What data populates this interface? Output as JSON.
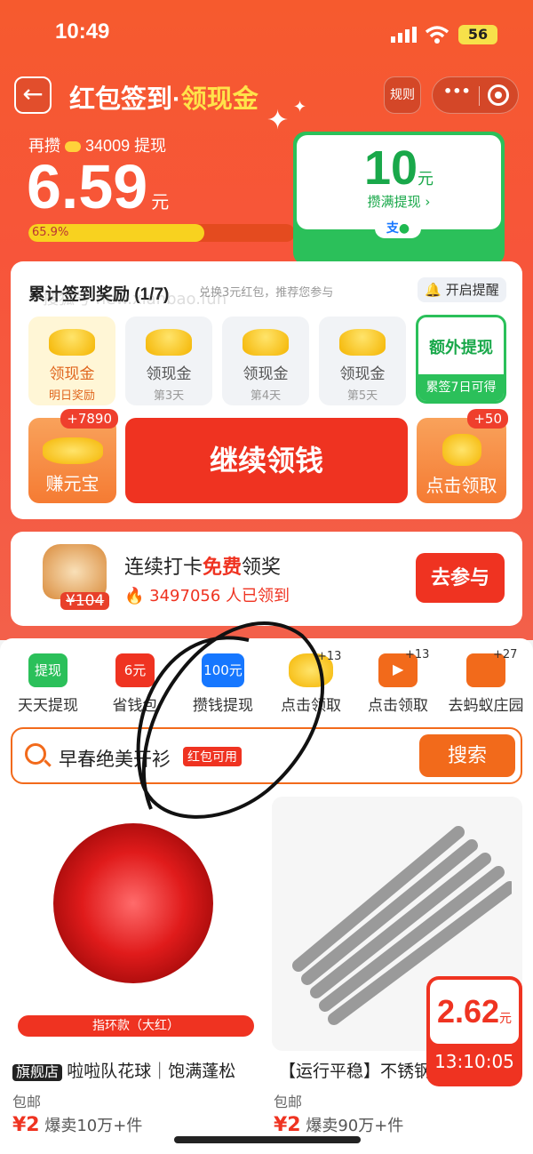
{
  "status": {
    "time": "10:49",
    "battery": "56"
  },
  "header": {
    "title": "红包签到",
    "dot": "·",
    "title_accent": "领现金",
    "rules": "规则",
    "more": "•••"
  },
  "balance": {
    "prefix": "再攒",
    "coins": "34009",
    "suffix": "提现",
    "amount": "6.59",
    "unit": "元",
    "progress_label": "65.9%",
    "progress": 0.659
  },
  "withdraw": {
    "amount": "10",
    "unit": "元",
    "label": "攒满提现 ›"
  },
  "signin": {
    "title": "累计签到奖励 (1/7)",
    "subtitle": "兑换3元红包，推荐您参与",
    "reminder": "开启提醒",
    "days": [
      {
        "label": "领现金",
        "sub": "明日奖励"
      },
      {
        "label": "领现金",
        "sub": "第3天"
      },
      {
        "label": "领现金",
        "sub": "第4天"
      },
      {
        "label": "领现金",
        "sub": "第5天"
      }
    ],
    "extra": {
      "label": "额外提现",
      "sub": "累签7日可得"
    },
    "earn": {
      "badge": "+7890",
      "label": "赚元宝"
    },
    "continue": "继续领钱",
    "claim": {
      "badge": "+50",
      "label": "点击领取"
    }
  },
  "promo": {
    "price": "¥104",
    "title_a": "连续打卡",
    "title_b": "免费",
    "title_c": "领奖",
    "count": "3497056 人已领到",
    "button": "去参与"
  },
  "shortcuts": [
    {
      "icon": "提现",
      "label": "天天提现"
    },
    {
      "icon": "6元",
      "label": "省钱包"
    },
    {
      "icon": "100元",
      "label": "攒钱提现"
    },
    {
      "icon": "+13",
      "label": "点击领取"
    },
    {
      "icon": "+13",
      "label": "点击领取"
    },
    {
      "icon": "+27",
      "label": "去蚂蚁庄园"
    }
  ],
  "search": {
    "text": "早春绝美开衫",
    "tag": "红包可用",
    "button": "搜索"
  },
  "products": [
    {
      "ribbon": "指环款（大红）",
      "shop": "旗舰店",
      "title": "啦啦队花球｜饱满蓬松",
      "shipping": "包邮",
      "price": "¥2",
      "sold": "爆卖10万+件"
    },
    {
      "title": "【运行平稳】不锈钢",
      "shipping": "包邮",
      "price": "¥2",
      "sold": "爆卖90万+件"
    }
  ],
  "float_reward": {
    "amount": "2.62",
    "unit": "元",
    "timer": "13:10:05"
  },
  "watermark": "搜狐号 new.xianbao.fun",
  "colors": {
    "primary": "#f5503a",
    "green": "#1fb950",
    "gold": "#f6c51b"
  }
}
